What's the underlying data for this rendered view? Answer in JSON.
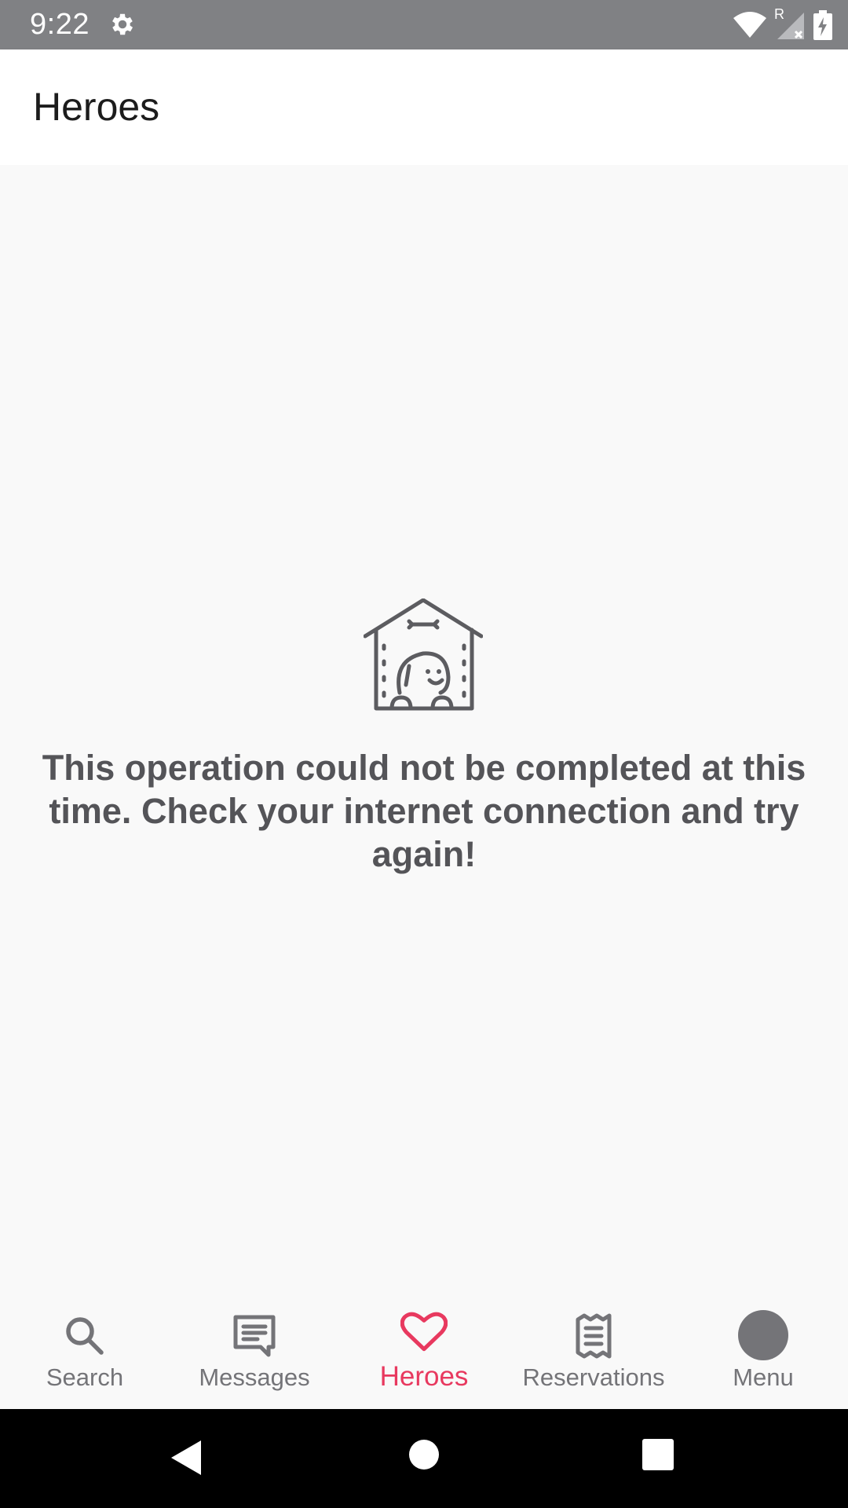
{
  "status_bar": {
    "time": "9:22",
    "icons": [
      "settings-gear-icon",
      "wifi-icon",
      "signal-roaming-icon",
      "battery-charging-icon"
    ],
    "roaming_label": "R"
  },
  "app_bar": {
    "title": "Heroes"
  },
  "empty_state": {
    "icon": "dog-house-icon",
    "message": "This operation could not be completed at this time. Check your internet connection and try again!"
  },
  "bottom_nav": {
    "items": [
      {
        "label": "Search",
        "icon": "search-icon",
        "active": false
      },
      {
        "label": "Messages",
        "icon": "message-icon",
        "active": false
      },
      {
        "label": "Heroes",
        "icon": "heart-icon",
        "active": true
      },
      {
        "label": "Reservations",
        "icon": "receipt-icon",
        "active": false
      },
      {
        "label": "Menu",
        "icon": "avatar-icon",
        "active": false
      }
    ]
  },
  "system_nav": {
    "buttons": [
      "back-icon",
      "home-icon",
      "recents-icon"
    ]
  },
  "colors": {
    "accent": "#e8395f",
    "status_bar": "#808184",
    "inactive": "#747478",
    "text_dark": "#1c1c1c",
    "message_text": "#545458"
  }
}
